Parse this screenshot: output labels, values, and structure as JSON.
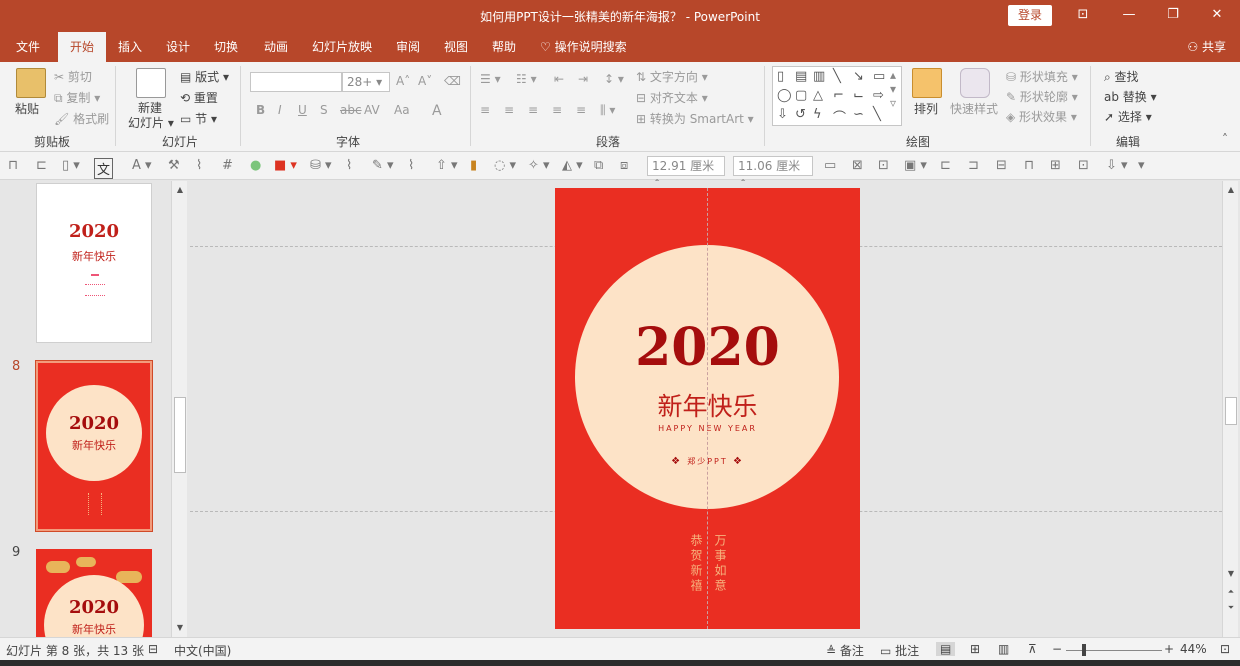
{
  "window": {
    "title": "如何用PPT设计一张精美的新年海报？ - PowerPoint",
    "login_label": "登录",
    "accent": "#b7472a"
  },
  "tabs": [
    "文件",
    "开始",
    "插入",
    "设计",
    "切换",
    "动画",
    "幻灯片放映",
    "审阅",
    "视图",
    "帮助",
    "操作说明搜索"
  ],
  "active_tab": "开始",
  "share_label": "共享",
  "ribbon": {
    "clipboard": {
      "label": "剪贴板",
      "paste": "粘贴",
      "cut": "剪切",
      "copy": "复制",
      "format_painter": "格式刷"
    },
    "slides": {
      "label": "幻灯片",
      "new_slide_1": "新建",
      "new_slide_2": "幻灯片",
      "layout": "版式",
      "reset": "重置",
      "section": "节"
    },
    "font": {
      "label": "字体",
      "size_value": "28+",
      "bold": "B",
      "italic": "I",
      "underline": "U",
      "shadow": "S",
      "strike": "abc",
      "spacing": "AV",
      "case": "Aa",
      "color": "A"
    },
    "paragraph": {
      "label": "段落",
      "text_direction": "文字方向",
      "align_text": "对齐文本",
      "smartart": "转换为 SmartArt"
    },
    "drawing": {
      "label": "绘图",
      "arrange": "排列",
      "quick_styles": "快速样式",
      "shape_fill": "形状填充",
      "shape_outline": "形状轮廓",
      "shape_effects": "形状效果"
    },
    "editing": {
      "label": "编辑",
      "find": "查找",
      "replace": "替换",
      "select": "选择"
    }
  },
  "quickbar": {
    "width_value": "12.91 厘米",
    "height_value": "11.06 厘米"
  },
  "thumbnails": [
    {
      "number": "",
      "year": "2020",
      "title": "新年快乐",
      "bg": "#ffffff"
    },
    {
      "number": "8",
      "year": "2020",
      "title": "新年快乐",
      "bg": "#ea2e22",
      "selected": true
    },
    {
      "number": "9",
      "year": "2020",
      "title": "新年快乐",
      "bg": "#ea2e22"
    }
  ],
  "slide": {
    "year": "2020",
    "title": "新年快乐",
    "subtitle": "HAPPY NEW YEAR",
    "author": "郑少PPT",
    "left_vertical": "恭贺新禧",
    "right_vertical": "万事如意",
    "bg_color": "#ea2e22",
    "circle_color": "#fde3c7"
  },
  "status": {
    "slide_info": "幻灯片 第 8 张，共 13 张",
    "language": "中文(中国)",
    "notes": "备注",
    "comments": "批注",
    "zoom": "44%"
  }
}
